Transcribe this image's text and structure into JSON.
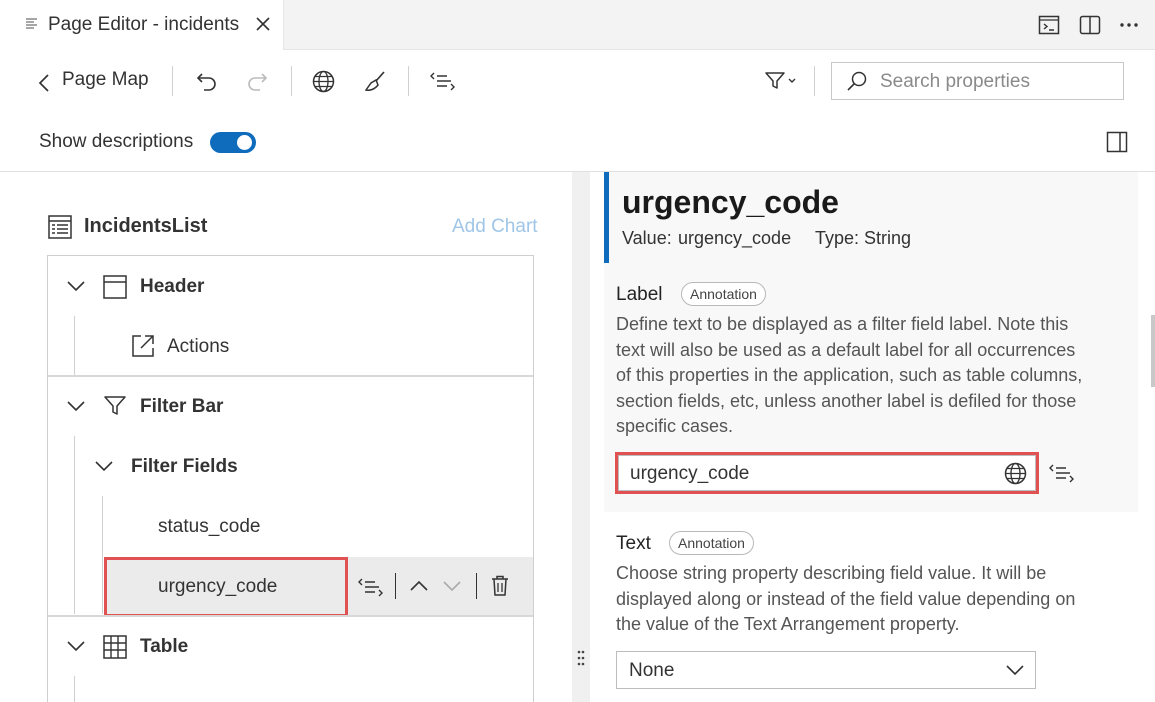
{
  "tab": {
    "title": "Page Editor - incidents"
  },
  "toolbar": {
    "back_label": "Page Map",
    "search_placeholder": "Search properties"
  },
  "options": {
    "show_descriptions_label": "Show descriptions",
    "show_descriptions_on": true
  },
  "outline": {
    "title": "IncidentsList",
    "add_chart": "Add Chart",
    "items": {
      "header": "Header",
      "actions": "Actions",
      "filter_bar": "Filter Bar",
      "filter_fields": "Filter Fields",
      "status_code": "status_code",
      "urgency_code": "urgency_code",
      "table": "Table"
    }
  },
  "property": {
    "name": "urgency_code",
    "value_label": "Value:",
    "value": "urgency_code",
    "type_label": "Type:",
    "type": "String",
    "label_section": {
      "title": "Label",
      "badge": "Annotation",
      "description": [
        "Define text to be displayed as a filter field label. Note this",
        "text will also be used as a default label for all occurrences",
        "of this properties in the application, such as table columns,",
        "section fields, etc, unless another label is defiled for those",
        "specific cases."
      ],
      "value": "urgency_code"
    },
    "text_section": {
      "title": "Text",
      "badge": "Annotation",
      "description": [
        "Choose string property describing field value. It will be",
        "displayed along or instead of the field value depending on",
        "the value of the Text Arrangement property."
      ],
      "selected": "None"
    }
  },
  "colors": {
    "accent": "#0f6cbd",
    "highlight": "#e05252"
  }
}
